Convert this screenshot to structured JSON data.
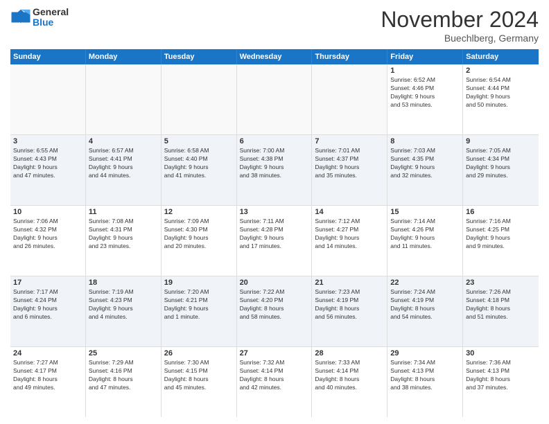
{
  "header": {
    "logo_text_general": "General",
    "logo_text_blue": "Blue",
    "month_title": "November 2024",
    "location": "Buechlberg, Germany"
  },
  "calendar": {
    "days_of_week": [
      "Sunday",
      "Monday",
      "Tuesday",
      "Wednesday",
      "Thursday",
      "Friday",
      "Saturday"
    ],
    "rows": [
      [
        {
          "day": "",
          "info": "",
          "empty": true
        },
        {
          "day": "",
          "info": "",
          "empty": true
        },
        {
          "day": "",
          "info": "",
          "empty": true
        },
        {
          "day": "",
          "info": "",
          "empty": true
        },
        {
          "day": "",
          "info": "",
          "empty": true
        },
        {
          "day": "1",
          "info": "Sunrise: 6:52 AM\nSunset: 4:46 PM\nDaylight: 9 hours\nand 53 minutes.",
          "empty": false
        },
        {
          "day": "2",
          "info": "Sunrise: 6:54 AM\nSunset: 4:44 PM\nDaylight: 9 hours\nand 50 minutes.",
          "empty": false
        }
      ],
      [
        {
          "day": "3",
          "info": "Sunrise: 6:55 AM\nSunset: 4:43 PM\nDaylight: 9 hours\nand 47 minutes.",
          "empty": false
        },
        {
          "day": "4",
          "info": "Sunrise: 6:57 AM\nSunset: 4:41 PM\nDaylight: 9 hours\nand 44 minutes.",
          "empty": false
        },
        {
          "day": "5",
          "info": "Sunrise: 6:58 AM\nSunset: 4:40 PM\nDaylight: 9 hours\nand 41 minutes.",
          "empty": false
        },
        {
          "day": "6",
          "info": "Sunrise: 7:00 AM\nSunset: 4:38 PM\nDaylight: 9 hours\nand 38 minutes.",
          "empty": false
        },
        {
          "day": "7",
          "info": "Sunrise: 7:01 AM\nSunset: 4:37 PM\nDaylight: 9 hours\nand 35 minutes.",
          "empty": false
        },
        {
          "day": "8",
          "info": "Sunrise: 7:03 AM\nSunset: 4:35 PM\nDaylight: 9 hours\nand 32 minutes.",
          "empty": false
        },
        {
          "day": "9",
          "info": "Sunrise: 7:05 AM\nSunset: 4:34 PM\nDaylight: 9 hours\nand 29 minutes.",
          "empty": false
        }
      ],
      [
        {
          "day": "10",
          "info": "Sunrise: 7:06 AM\nSunset: 4:32 PM\nDaylight: 9 hours\nand 26 minutes.",
          "empty": false
        },
        {
          "day": "11",
          "info": "Sunrise: 7:08 AM\nSunset: 4:31 PM\nDaylight: 9 hours\nand 23 minutes.",
          "empty": false
        },
        {
          "day": "12",
          "info": "Sunrise: 7:09 AM\nSunset: 4:30 PM\nDaylight: 9 hours\nand 20 minutes.",
          "empty": false
        },
        {
          "day": "13",
          "info": "Sunrise: 7:11 AM\nSunset: 4:28 PM\nDaylight: 9 hours\nand 17 minutes.",
          "empty": false
        },
        {
          "day": "14",
          "info": "Sunrise: 7:12 AM\nSunset: 4:27 PM\nDaylight: 9 hours\nand 14 minutes.",
          "empty": false
        },
        {
          "day": "15",
          "info": "Sunrise: 7:14 AM\nSunset: 4:26 PM\nDaylight: 9 hours\nand 11 minutes.",
          "empty": false
        },
        {
          "day": "16",
          "info": "Sunrise: 7:16 AM\nSunset: 4:25 PM\nDaylight: 9 hours\nand 9 minutes.",
          "empty": false
        }
      ],
      [
        {
          "day": "17",
          "info": "Sunrise: 7:17 AM\nSunset: 4:24 PM\nDaylight: 9 hours\nand 6 minutes.",
          "empty": false
        },
        {
          "day": "18",
          "info": "Sunrise: 7:19 AM\nSunset: 4:23 PM\nDaylight: 9 hours\nand 4 minutes.",
          "empty": false
        },
        {
          "day": "19",
          "info": "Sunrise: 7:20 AM\nSunset: 4:21 PM\nDaylight: 9 hours\nand 1 minute.",
          "empty": false
        },
        {
          "day": "20",
          "info": "Sunrise: 7:22 AM\nSunset: 4:20 PM\nDaylight: 8 hours\nand 58 minutes.",
          "empty": false
        },
        {
          "day": "21",
          "info": "Sunrise: 7:23 AM\nSunset: 4:19 PM\nDaylight: 8 hours\nand 56 minutes.",
          "empty": false
        },
        {
          "day": "22",
          "info": "Sunrise: 7:24 AM\nSunset: 4:19 PM\nDaylight: 8 hours\nand 54 minutes.",
          "empty": false
        },
        {
          "day": "23",
          "info": "Sunrise: 7:26 AM\nSunset: 4:18 PM\nDaylight: 8 hours\nand 51 minutes.",
          "empty": false
        }
      ],
      [
        {
          "day": "24",
          "info": "Sunrise: 7:27 AM\nSunset: 4:17 PM\nDaylight: 8 hours\nand 49 minutes.",
          "empty": false
        },
        {
          "day": "25",
          "info": "Sunrise: 7:29 AM\nSunset: 4:16 PM\nDaylight: 8 hours\nand 47 minutes.",
          "empty": false
        },
        {
          "day": "26",
          "info": "Sunrise: 7:30 AM\nSunset: 4:15 PM\nDaylight: 8 hours\nand 45 minutes.",
          "empty": false
        },
        {
          "day": "27",
          "info": "Sunrise: 7:32 AM\nSunset: 4:14 PM\nDaylight: 8 hours\nand 42 minutes.",
          "empty": false
        },
        {
          "day": "28",
          "info": "Sunrise: 7:33 AM\nSunset: 4:14 PM\nDaylight: 8 hours\nand 40 minutes.",
          "empty": false
        },
        {
          "day": "29",
          "info": "Sunrise: 7:34 AM\nSunset: 4:13 PM\nDaylight: 8 hours\nand 38 minutes.",
          "empty": false
        },
        {
          "day": "30",
          "info": "Sunrise: 7:36 AM\nSunset: 4:13 PM\nDaylight: 8 hours\nand 37 minutes.",
          "empty": false
        }
      ]
    ]
  }
}
